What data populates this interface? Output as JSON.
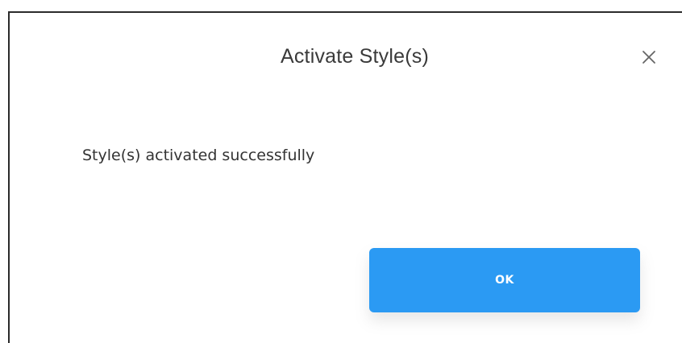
{
  "dialog": {
    "title": "Activate Style(s)",
    "message": "Style(s) activated successfully",
    "ok_label": "OK",
    "close_icon": "close-icon"
  },
  "colors": {
    "primary_button": "#2b9af3",
    "title_text": "#3a3a3a",
    "message_text": "#333333"
  }
}
